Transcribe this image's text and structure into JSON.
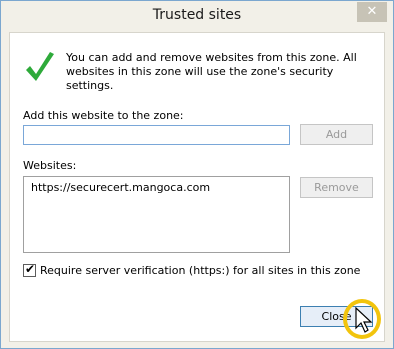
{
  "window": {
    "title": "Trusted sites",
    "close_glyph": "✕"
  },
  "info": {
    "icon": "green-checkmark-icon",
    "text": "You can add and remove websites from this zone. All websites in this zone will use the zone's security settings."
  },
  "add": {
    "label": "Add this website to the zone:",
    "value": "",
    "button": "Add"
  },
  "websites": {
    "label": "Websites:",
    "items": [
      "https://securecert.mangoca.com"
    ],
    "remove_button": "Remove"
  },
  "verification": {
    "checked": true,
    "label": "Require server verification (https:) for all sites in this zone"
  },
  "footer": {
    "close_button": "Close"
  },
  "colors": {
    "accent_check": "#2eaa3a",
    "highlight": "#f2c40c",
    "focus_border": "#3c7fb1"
  }
}
